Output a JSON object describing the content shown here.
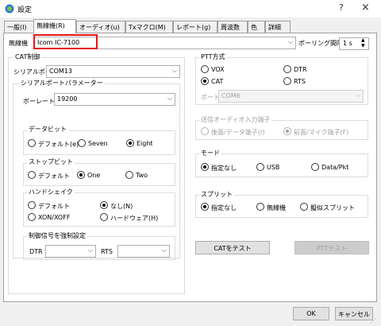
{
  "window": {
    "title": "設定",
    "help": "?",
    "close": "×"
  },
  "tabs": [
    "一般(I)",
    "無線機(R)",
    "オーディオ(u)",
    "Txマクロ(M)",
    "レポート(g)",
    "周波数",
    "色",
    "詳細"
  ],
  "radio": {
    "label": "無線機",
    "value": "Icom IC-7100",
    "polling_label": "ポーリング間隔",
    "polling_value": "1 s"
  },
  "cat": {
    "title": "CAT制御",
    "serial_port_label": "シリアルポート",
    "serial_port_value": "COM13",
    "serial_params_title": "シリアルポートパラメーター",
    "baud_label": "ボーレート",
    "baud_value": "19200",
    "data_bits": {
      "title": "データビット",
      "options": [
        "デフォルト(e)",
        "Seven",
        "Eight"
      ],
      "selected": 2
    },
    "stop_bits": {
      "title": "ストップビット",
      "options": [
        "デフォルト",
        "One",
        "Two"
      ],
      "selected": 1
    },
    "handshake": {
      "title": "ハンドシェイク",
      "options": [
        "デフォルト",
        "なし(N)",
        "XON/XOFF",
        "ハードウェア(H)"
      ],
      "selected": 1
    },
    "force": {
      "title": "制御信号を強制設定",
      "dtr_label": "DTR",
      "rts_label": "RTS"
    }
  },
  "ptt": {
    "title": "PTT方式",
    "options": [
      "VOX",
      "DTR",
      "CAT",
      "RTS"
    ],
    "selected": 2,
    "port_label": "ポート",
    "port_value": "COM6"
  },
  "audio_out": {
    "title": "送信オーディオ入力端子",
    "options": [
      "後面/データ端子(/)",
      "前面/マイク端子(F)"
    ],
    "selected": 1
  },
  "mode": {
    "title": "モード",
    "options": [
      "指定なし",
      "USB",
      "Data/Pkt"
    ],
    "selected": 0
  },
  "split": {
    "title": "スプリット",
    "options": [
      "指定なし",
      "無線機",
      "擬似スプリット"
    ],
    "selected": 0
  },
  "buttons": {
    "test_cat": "CATをテスト",
    "test_ptt": "PTTテスト",
    "ok": "OK",
    "cancel": "キャンセル"
  },
  "colors": {
    "highlight": "#e81414"
  }
}
